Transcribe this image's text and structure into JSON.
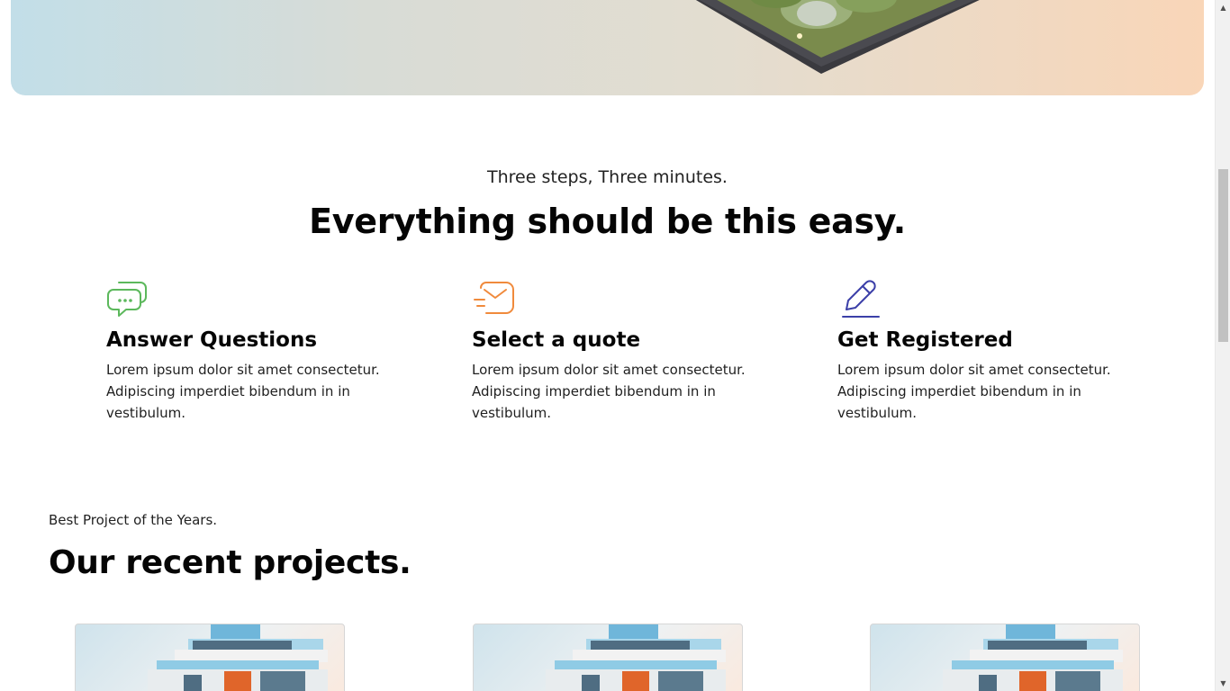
{
  "steps": {
    "kicker": "Three steps, Three minutes.",
    "title": "Everything should be this easy.",
    "items": [
      {
        "icon": "chat-bubbles-icon",
        "icon_color": "#5cb85c",
        "title": "Answer Questions",
        "description": "Lorem ipsum dolor sit amet consectetur. Adipiscing imperdiet bibendum in in vestibulum."
      },
      {
        "icon": "envelope-send-icon",
        "icon_color": "#f08a3c",
        "title": "Select a quote",
        "description": "Lorem ipsum dolor sit amet consectetur. Adipiscing imperdiet bibendum in in vestibulum."
      },
      {
        "icon": "pencil-icon",
        "icon_color": "#3b3fa8",
        "title": "Get Registered",
        "description": "Lorem ipsum dolor sit amet consectetur. Adipiscing imperdiet bibendum in in vestibulum."
      }
    ]
  },
  "projects": {
    "kicker": "Best Project of the Years.",
    "title": "Our recent projects.",
    "cards": [
      {
        "image": "modern-house-image"
      },
      {
        "image": "modern-house-image"
      },
      {
        "image": "modern-house-image"
      }
    ]
  },
  "scrollbar": {
    "up_arrow": "▲",
    "down_arrow": "▼"
  }
}
